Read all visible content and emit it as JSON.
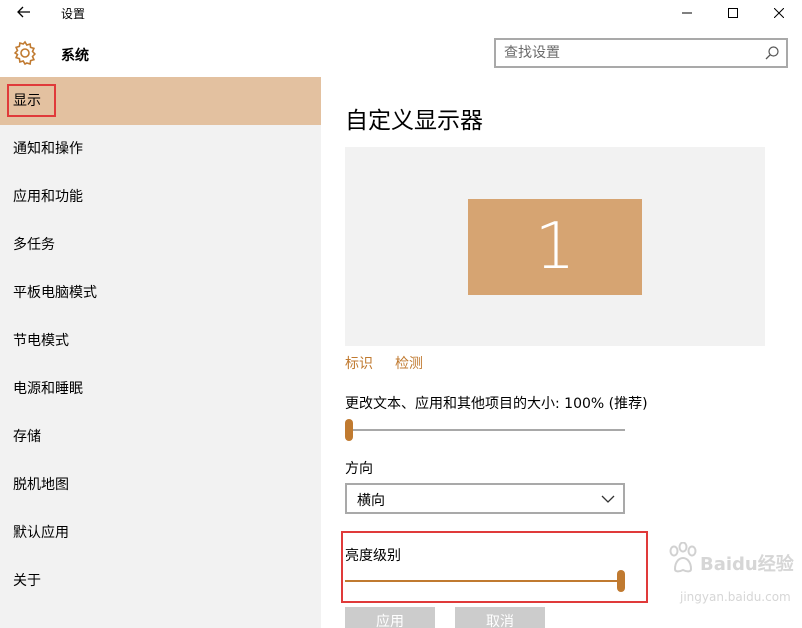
{
  "window": {
    "title": "设置"
  },
  "header": {
    "section_title": "系统",
    "search_placeholder": "查找设置"
  },
  "sidebar": {
    "items": [
      {
        "label": "显示",
        "active": true
      },
      {
        "label": "通知和操作"
      },
      {
        "label": "应用和功能"
      },
      {
        "label": "多任务"
      },
      {
        "label": "平板电脑模式"
      },
      {
        "label": "节电模式"
      },
      {
        "label": "电源和睡眠"
      },
      {
        "label": "存储"
      },
      {
        "label": "脱机地图"
      },
      {
        "label": "默认应用"
      },
      {
        "label": "关于"
      }
    ]
  },
  "main": {
    "page_title": "自定义显示器",
    "monitor_number": "1",
    "identify_link": "标识",
    "detect_link": "检测",
    "scale_label": "更改文本、应用和其他项目的大小: 100% (推荐)",
    "scale_value_percent": 0,
    "orientation_label": "方向",
    "orientation_value": "横向",
    "brightness_label": "亮度级别",
    "brightness_value_percent": 100,
    "apply_label": "应用",
    "cancel_label": "取消"
  },
  "watermark": {
    "text": "Baidu经验",
    "url": "jingyan.baidu.com"
  },
  "colors": {
    "accent": "#c07a30",
    "active_nav": "#e3c1a0",
    "monitor": "#d6a472",
    "highlight": "#e03a3a"
  }
}
